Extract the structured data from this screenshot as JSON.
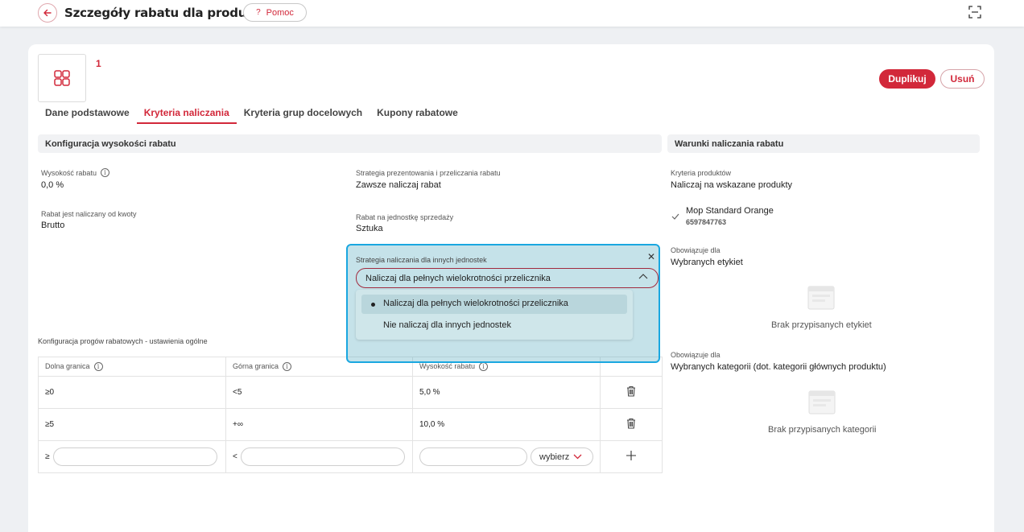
{
  "header": {
    "title": "Szczegóły rabatu dla produktów",
    "help_label": "Pomoc"
  },
  "record": {
    "id": "1",
    "duplicate_label": "Duplikuj",
    "delete_label": "Usuń"
  },
  "tabs": [
    {
      "label": "Dane podstawowe",
      "active": false
    },
    {
      "label": "Kryteria naliczania",
      "active": true
    },
    {
      "label": "Kryteria grup docelowych",
      "active": false
    },
    {
      "label": "Kupony rabatowe",
      "active": false
    }
  ],
  "config": {
    "title": "Konfiguracja wysokości rabatu",
    "discount_label": "Wysokość rabatu",
    "discount_value": "0,0 %",
    "strategy_label": "Strategia prezentowania i przeliczania rabatu",
    "strategy_value": "Zawsze naliczaj rabat",
    "base_label": "Rabat jest naliczany od kwoty",
    "base_value": "Brutto",
    "unit_label": "Rabat na jednostkę sprzedaży",
    "unit_value": "Sztuka"
  },
  "thresholds": {
    "title": "Konfiguracja progów rabatowych - ustawienia ogólne",
    "headers": [
      "Dolna granica",
      "Górna granica",
      "Wysokość rabatu"
    ],
    "rows": [
      {
        "lower": "≥0",
        "upper": "<5",
        "discount": "5,0 %"
      },
      {
        "lower": "≥5",
        "upper": "+∞",
        "discount": "10,0 %"
      }
    ],
    "new_row": {
      "lower_prefix": "≥",
      "upper_prefix": "<",
      "select_label": "wybierz"
    }
  },
  "conditions": {
    "title": "Warunki naliczania rabatu",
    "product_criteria_label": "Kryteria produktów",
    "product_criteria_value": "Naliczaj na wskazane produkty",
    "product_name": "Mop Standard Orange",
    "product_code": "6597847763",
    "applies_label_1": "Obowiązuje dla",
    "applies_value_1": "Wybranych etykiet",
    "empty_labels": "Brak przypisanych etykiet",
    "applies_label_2": "Obowiązuje dla",
    "applies_value_2": "Wybranych kategorii (dot. kategorii głównych produktu)",
    "empty_categories": "Brak przypisanych kategorii"
  },
  "popup": {
    "label": "Strategia naliczania dla innych jednostek",
    "selected": "Naliczaj dla pełnych wielokrotności przelicznika",
    "options": [
      "Naliczaj dla pełnych wielokrotności przelicznika",
      "Nie naliczaj dla innych jednostek"
    ]
  },
  "colors": {
    "accent": "#d2283a",
    "highlight_border": "#1aa7e0"
  }
}
